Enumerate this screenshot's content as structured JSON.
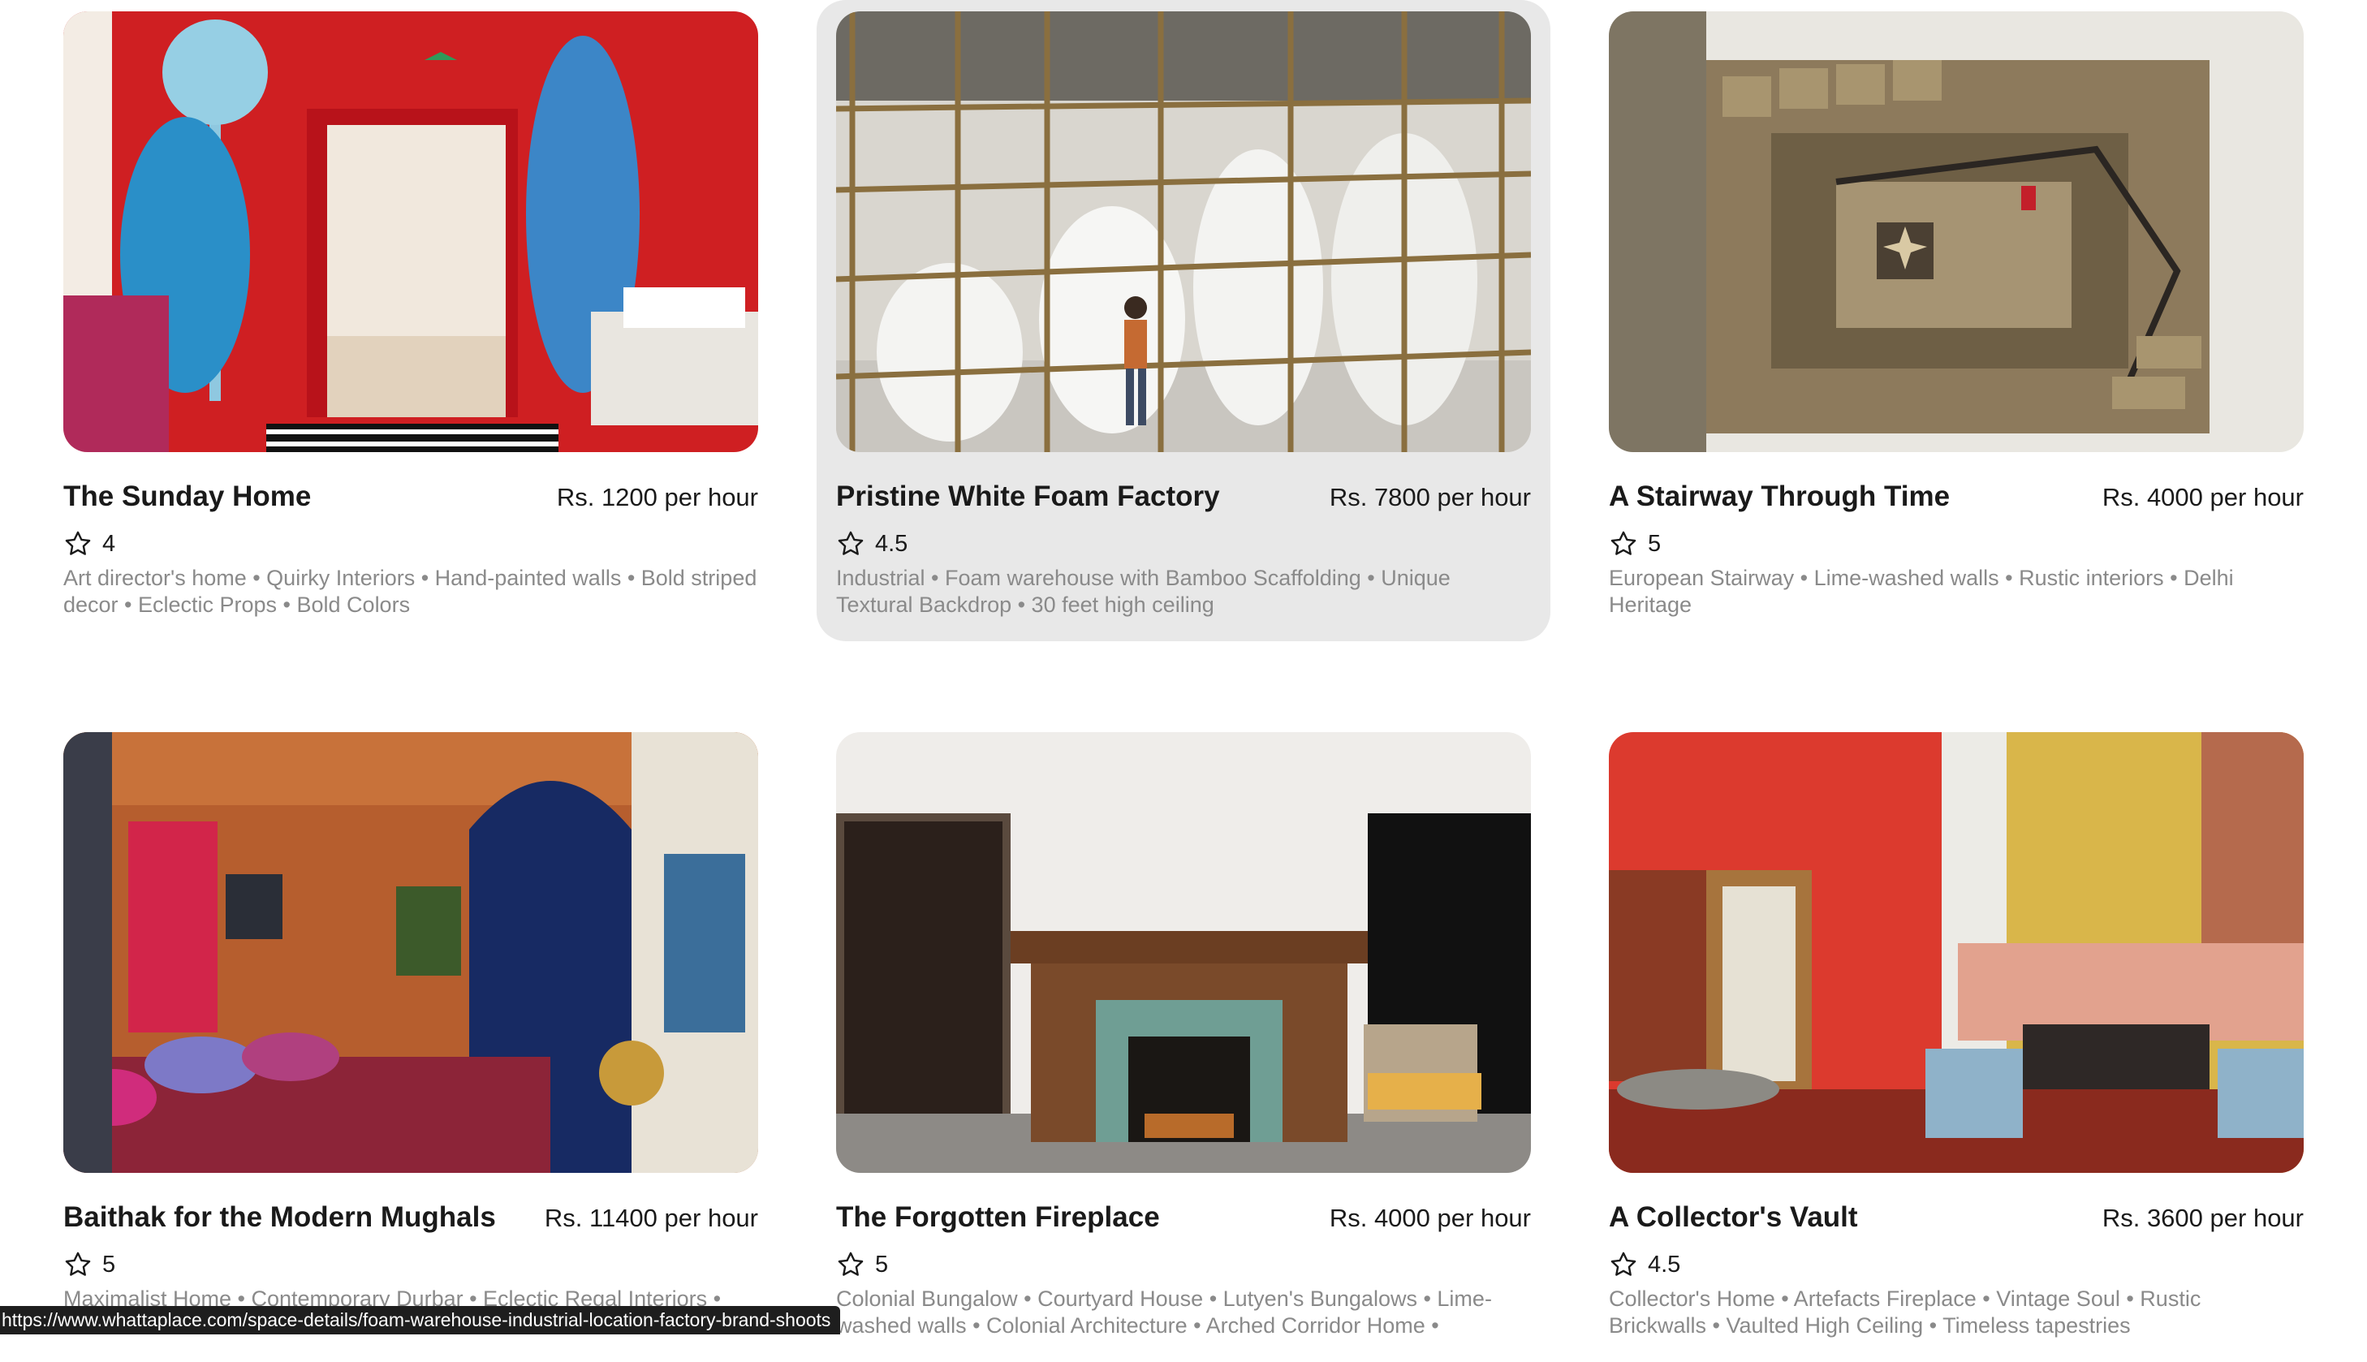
{
  "listings": [
    {
      "title": "The Sunday Home",
      "price": "Rs. 1200",
      "price_unit": "per hour",
      "rating": "4",
      "tags": "Art director's home • Quirky Interiors • Hand-painted walls • Bold striped decor • Eclectic Props • Bold Colors",
      "photo": "red-room-with-painted-palm-tree"
    },
    {
      "title": "Pristine White Foam Factory",
      "price": "Rs. 7800",
      "price_unit": "per hour",
      "rating": "4.5",
      "tags": "Industrial • Foam warehouse with Bamboo Scaffolding • Unique Textural Backdrop • 30 feet high ceiling",
      "photo": "bamboo-scaffolding-foam-warehouse"
    },
    {
      "title": "A Stairway Through Time",
      "price": "Rs. 4000",
      "price_unit": "per hour",
      "rating": "5",
      "tags": "European Stairway • Lime-washed walls • Rustic interiors • Delhi Heritage",
      "photo": "spiral-stone-stairway-from-above"
    },
    {
      "title": "Baithak for the Modern Mughals",
      "price": "Rs. 11400",
      "price_unit": "per hour",
      "rating": "5",
      "tags": "Maximalist Home • Contemporary Durbar • Eclectic Regal Interiors •",
      "photo": "orange-and-blue-maximalist-lounge"
    },
    {
      "title": "The Forgotten Fireplace",
      "price": "Rs. 4000",
      "price_unit": "per hour",
      "rating": "5",
      "tags": "Colonial Bungalow • Courtyard House • Lutyen's Bungalows • Lime-washed walls • Colonial Architecture • Arched Corridor Home •",
      "photo": "colonial-room-with-wooden-fireplace"
    },
    {
      "title": "A Collector's Vault",
      "price": "Rs. 3600",
      "price_unit": "per hour",
      "rating": "4.5",
      "tags": "Collector's Home • Artefacts Fireplace • Vintage Soul • Rustic Brickwalls • Vaulted High Ceiling • Timeless tapestries",
      "photo": "red-walled-collectors-living-room"
    }
  ],
  "hovered_index": 1,
  "status_bar": {
    "url": "https://www.whattaplace.com/space-details/foam-warehouse-industrial-location-factory-brand-shoots"
  },
  "colors": {
    "hover_background": "#e8e8e8",
    "tag_text": "#8a8a8a",
    "status_bar_background": "#1e1e1e"
  },
  "icons": {
    "rating": "star-outline-icon"
  }
}
